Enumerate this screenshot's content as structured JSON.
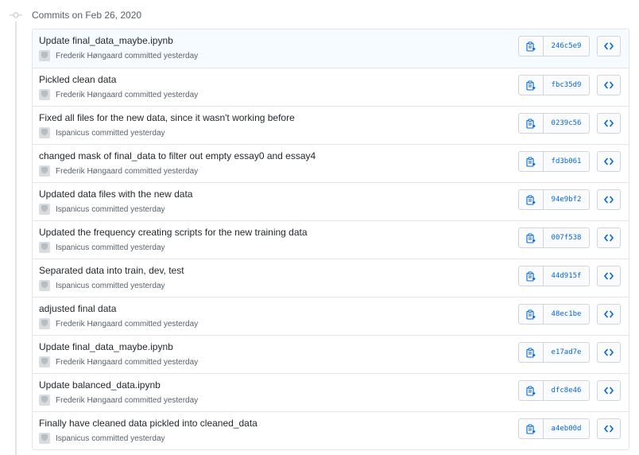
{
  "day_header": {
    "title": "Commits on Feb 26, 2020"
  },
  "icons": {
    "copy": "clippy-icon",
    "browse": "code-icon",
    "timeline": "commit-dot-icon"
  },
  "colors": {
    "link": "#0366d6",
    "border": "#e1e4e8",
    "muted": "#586069",
    "highlight_row": "#f6fbff"
  },
  "commits": [
    {
      "title": "Update final_data_maybe.ipynb",
      "author": "Frederik Høngaard",
      "action": "committed yesterday",
      "sha": "246c5e9"
    },
    {
      "title": "Pickled clean data",
      "author": "Frederik Høngaard",
      "action": "committed yesterday",
      "sha": "fbc35d9"
    },
    {
      "title": "Fixed all files for the new data, since it wasn't working before",
      "author": "Ispanicus",
      "action": "committed yesterday",
      "sha": "0239c56"
    },
    {
      "title": "changed mask of final_data to filter out empty essay0 and essay4",
      "author": "Frederik Høngaard",
      "action": "committed yesterday",
      "sha": "fd3b061"
    },
    {
      "title": "Updated data files with the new data",
      "author": "Ispanicus",
      "action": "committed yesterday",
      "sha": "94e9bf2"
    },
    {
      "title": "Updated the frequency creating scripts for the new training data",
      "author": "Ispanicus",
      "action": "committed yesterday",
      "sha": "007f538"
    },
    {
      "title": "Separated data into train, dev, test",
      "author": "Ispanicus",
      "action": "committed yesterday",
      "sha": "44d915f"
    },
    {
      "title": "adjusted final data",
      "author": "Frederik Høngaard",
      "action": "committed yesterday",
      "sha": "48ec1be"
    },
    {
      "title": "Update final_data_maybe.ipynb",
      "author": "Frederik Høngaard",
      "action": "committed yesterday",
      "sha": "e17ad7e"
    },
    {
      "title": "Update balanced_data.ipynb",
      "author": "Frederik Høngaard",
      "action": "committed yesterday",
      "sha": "dfc8e46"
    },
    {
      "title": "Finally have cleaned data pickled into cleaned_data",
      "author": "Ispanicus",
      "action": "committed yesterday",
      "sha": "a4eb00d"
    }
  ]
}
